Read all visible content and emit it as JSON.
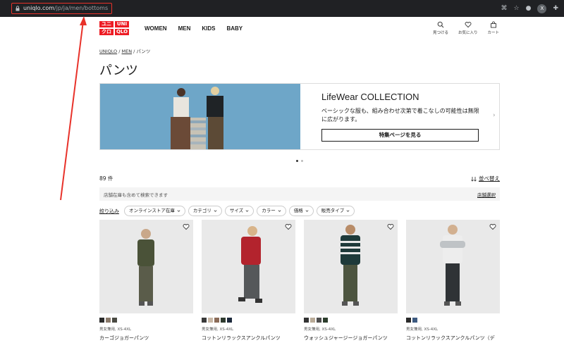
{
  "browser": {
    "url_host": "uniqlo.com",
    "url_path": "/jp/ja/men/bottoms",
    "avatar_letter": "X"
  },
  "header": {
    "logo": [
      "ユニ",
      "UNI",
      "クロ",
      "QLO"
    ],
    "nav": [
      "WOMEN",
      "MEN",
      "KIDS",
      "BABY"
    ],
    "icons": [
      {
        "icon": "search-icon",
        "label": "見つける"
      },
      {
        "icon": "heart-icon",
        "label": "お気に入り"
      },
      {
        "icon": "cart-icon",
        "label": "カート"
      }
    ]
  },
  "breadcrumb": {
    "home": "UNIQLO",
    "sep1": " / ",
    "men": "MEN",
    "sep2": " / ",
    "current": "パンツ"
  },
  "page_title": "パンツ",
  "banner": {
    "title": "LifeWear COLLECTION",
    "description": "ベーシックな服も、組み合わせ次第で着こなしの可能性は無限に広がります。",
    "button": "特集ページを見る",
    "next": "›"
  },
  "results": {
    "count": "89 件",
    "sort": "並べ替え"
  },
  "store": {
    "text": "店舗在庫も含めて検索できます",
    "link": "店舗選択"
  },
  "filters": {
    "first": "絞り込み",
    "chips": [
      "オンラインストア在庫",
      "カテゴリ",
      "サイズ",
      "カラー",
      "価格",
      "販売タイプ"
    ]
  },
  "products": [
    {
      "meta": "男女兼用, XS-4XL",
      "name": "カーゴジョガーパンツ",
      "swatches": [
        "#2b2b2b",
        "#8a7a6b",
        "#4a4a42"
      ]
    },
    {
      "meta": "男女兼用, XS-4XL",
      "name": "コットンリラックスアンクルパンツ",
      "swatches": [
        "#3a3a3a",
        "#c9b8a6",
        "#8b6b58",
        "#2f3b2f",
        "#1e2a3c"
      ]
    },
    {
      "meta": "男女兼用, XS-4XL",
      "name": "ウォッシュジャージージョガーパンツ",
      "swatches": [
        "#333333",
        "#b9ab98",
        "#4e4e4e",
        "#2c3d2c"
      ]
    },
    {
      "meta": "男女兼用, XS-4XL",
      "name": "コットンリラックスアンクルパンツ（デ",
      "swatches": [
        "#2a2a2a",
        "#3d5a80"
      ]
    }
  ]
}
